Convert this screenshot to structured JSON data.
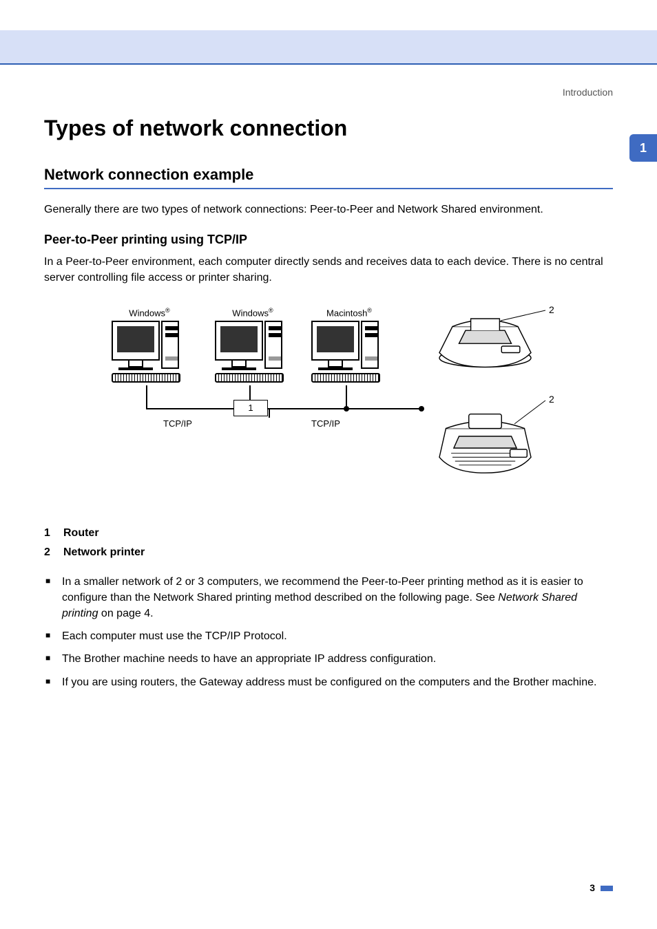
{
  "header": {
    "section": "Introduction",
    "chapter_tab": "1"
  },
  "titles": {
    "h1": "Types of network connection",
    "h2": "Network connection example",
    "h3": "Peer-to-Peer printing using TCP/IP"
  },
  "paragraphs": {
    "intro": "Generally there are two types of network connections: Peer-to-Peer and Network Shared environment.",
    "p2p": "In a Peer-to-Peer environment, each computer directly sends and receives data to each device. There is no central server controlling file access or printer sharing."
  },
  "diagram": {
    "c1": "Windows",
    "c2": "Windows",
    "c3": "Macintosh",
    "reg": "®",
    "router_num": "1",
    "printer_num_a": "2",
    "printer_num_b": "2",
    "tcpip_left": "TCP/IP",
    "tcpip_right": "TCP/IP"
  },
  "legend": {
    "n1": "1",
    "l1": "Router",
    "n2": "2",
    "l2": "Network printer"
  },
  "bullets": {
    "b1a": "In a smaller network of 2 or 3 computers, we recommend the Peer-to-Peer printing method as it is easier to configure than the Network Shared printing method described on the following page. See ",
    "b1_link": "Network Shared printing",
    "b1b": " on page 4.",
    "b2": "Each computer must use the TCP/IP Protocol.",
    "b3": "The Brother machine needs to have an appropriate IP address configuration.",
    "b4": "If you are using routers, the Gateway address must be configured on the computers and the Brother machine."
  },
  "footer": {
    "page": "3"
  }
}
